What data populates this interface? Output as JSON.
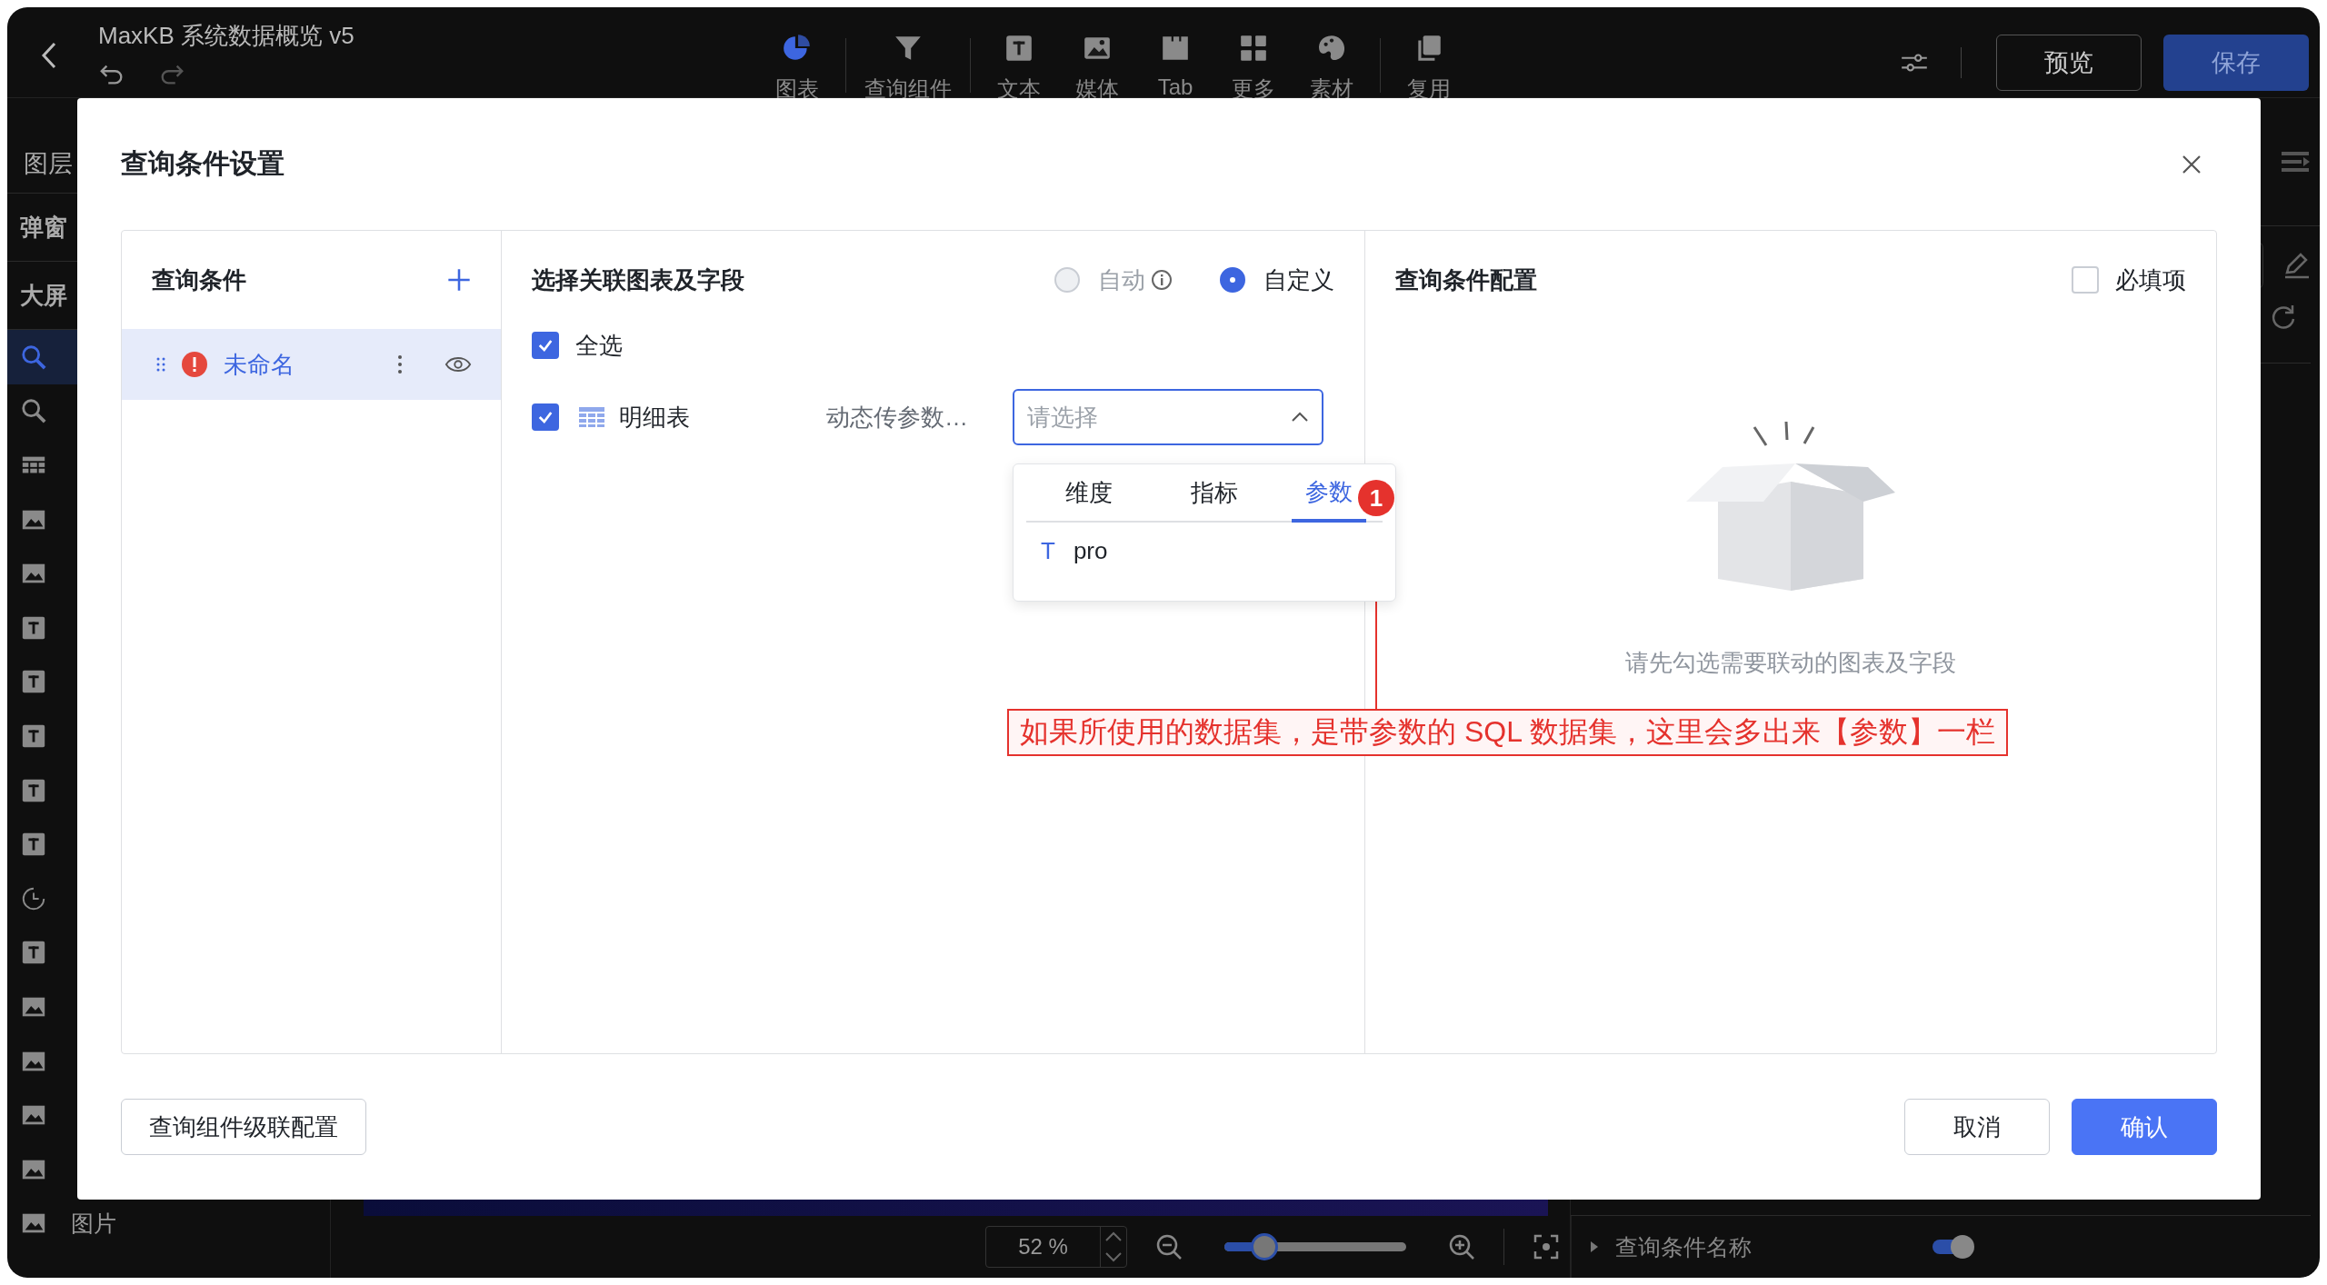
{
  "editor": {
    "title": "MaxKB 系统数据概览 v5",
    "toolbar": [
      {
        "kind": "chart",
        "label": "图表",
        "selected": true
      },
      {
        "kind": "filter",
        "label": "查询组件",
        "selected": false
      },
      {
        "kind": "text",
        "label": "文本",
        "selected": false
      },
      {
        "kind": "media",
        "label": "媒体",
        "selected": false
      },
      {
        "kind": "tab",
        "label": "Tab",
        "selected": false
      },
      {
        "kind": "more",
        "label": "更多",
        "selected": false
      },
      {
        "kind": "palette",
        "label": "素材",
        "selected": false
      },
      {
        "kind": "copy",
        "label": "复用",
        "selected": false
      }
    ],
    "preview_button": "预览",
    "save_button": "保存"
  },
  "layers": {
    "title": "图层",
    "sections": [
      "弹窗",
      "大屏"
    ],
    "items": [
      {
        "kind": "query",
        "selected": true
      },
      {
        "kind": "query",
        "selected": false
      },
      {
        "kind": "table",
        "selected": false
      },
      {
        "kind": "image",
        "selected": false
      },
      {
        "kind": "image",
        "selected": false
      },
      {
        "kind": "text",
        "selected": false
      },
      {
        "kind": "text",
        "selected": false
      },
      {
        "kind": "text",
        "selected": false
      },
      {
        "kind": "text",
        "selected": false
      },
      {
        "kind": "text",
        "selected": false
      },
      {
        "kind": "time",
        "selected": false
      },
      {
        "kind": "text",
        "selected": false
      },
      {
        "kind": "image",
        "selected": false
      },
      {
        "kind": "image",
        "selected": false
      },
      {
        "kind": "image",
        "selected": false
      },
      {
        "kind": "image",
        "selected": false
      },
      {
        "kind": "image",
        "label": "图片",
        "selected": false
      }
    ]
  },
  "zoom": {
    "value": "52 %",
    "level": 0.22
  },
  "property_panel": {
    "section": "查询条件名称",
    "toggle_on": true
  },
  "dialog": {
    "title": "查询条件设置",
    "conditions": {
      "title": "查询条件",
      "items": [
        {
          "label": "未命名",
          "error": true,
          "selected": true
        }
      ]
    },
    "link": {
      "title": "选择关联图表及字段",
      "modes": [
        {
          "label": "自动",
          "selected": false,
          "disabled": true,
          "info": true
        },
        {
          "label": "自定义",
          "selected": true,
          "disabled": false,
          "info": false
        }
      ],
      "select_all": {
        "label": "全选",
        "checked": true
      },
      "charts": [
        {
          "label": "明细表",
          "checked": true,
          "field_label": "动态传参数…",
          "placeholder": "请选择",
          "open": true
        }
      ]
    },
    "dropdown": {
      "tabs": [
        {
          "label": "维度",
          "selected": false
        },
        {
          "label": "指标",
          "selected": false
        },
        {
          "label": "参数",
          "selected": true
        }
      ],
      "options": [
        {
          "type_icon": "T",
          "label": "pro"
        }
      ]
    },
    "config": {
      "title": "查询条件配置",
      "required": {
        "label": "必填项",
        "checked": false
      },
      "empty_text": "请先勾选需要联动的图表及字段"
    },
    "footer": {
      "cascade_button": "查询组件级联配置",
      "cancel": "取消",
      "confirm": "确认"
    }
  },
  "annotation": {
    "badge": "1",
    "text": "如果所使用的数据集，是带参数的 SQL 数据集，这里会多出来【参数】一栏"
  }
}
